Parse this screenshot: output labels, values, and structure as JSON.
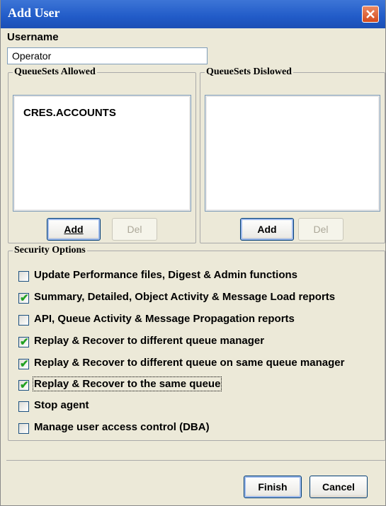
{
  "window": {
    "title": "Add User"
  },
  "username": {
    "label": "Username",
    "value": "Operator"
  },
  "allowed": {
    "legend": "QueueSets Allowed",
    "items": [
      "CRES.ACCOUNTS"
    ],
    "add_label": "Add",
    "del_label": "Del"
  },
  "disallowed": {
    "legend": "QueueSets Dislowed",
    "items": [],
    "add_label": "Add",
    "del_label": "Del"
  },
  "security": {
    "legend": "Security Options",
    "options": [
      {
        "label": "Update Performance files, Digest & Admin functions",
        "checked": false
      },
      {
        "label": "Summary, Detailed, Object Activity & Message Load reports",
        "checked": true
      },
      {
        "label": "API, Queue Activity & Message Propagation reports",
        "checked": false
      },
      {
        "label": "Replay & Recover to different queue manager",
        "checked": true
      },
      {
        "label": "Replay & Recover to different queue on same queue manager",
        "checked": true
      },
      {
        "label": "Replay & Recover to the same queue",
        "checked": true
      },
      {
        "label": "Stop agent",
        "checked": false
      },
      {
        "label": "Manage user access control (DBA)",
        "checked": false
      }
    ]
  },
  "footer": {
    "finish_label": "Finish",
    "cancel_label": "Cancel"
  },
  "colors": {
    "titlebar": "#215bc8",
    "dialog_bg": "#ece9d8",
    "close": "#d44a1d",
    "check": "#21a121"
  }
}
